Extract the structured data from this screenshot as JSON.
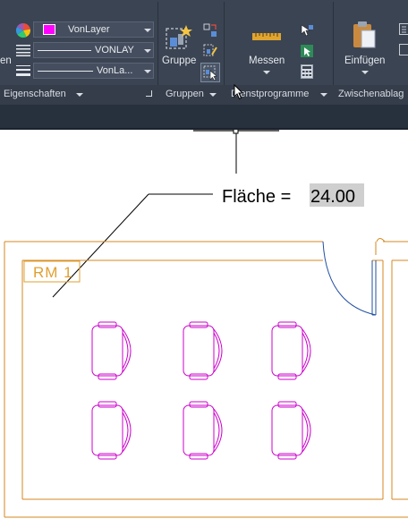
{
  "ribbon": {
    "eigenschaften": {
      "panel_label": "Eigenschaften",
      "left_cut_label": "en",
      "color_value": "VonLayer",
      "linetype_value": "VONLAY",
      "lineweight_value": "VonLa..."
    },
    "gruppen": {
      "panel_label": "Gruppen",
      "gruppe_label": "Gruppe"
    },
    "dienstprogramme": {
      "panel_label": "Dienstprogramme",
      "messen_label": "Messen"
    },
    "zwischenablage": {
      "panel_label": "Zwischenablag",
      "einfuegen_label": "Einfügen"
    }
  },
  "drawing": {
    "measure_prefix": "Fläche = ",
    "measure_value": "24.00",
    "room_tag": "RM 1",
    "colors": {
      "wall": "#d4871f",
      "furniture": "#cc00cc",
      "door": "#1f4fa0",
      "leader": "#000000",
      "swatch": "#ff00ff"
    }
  }
}
